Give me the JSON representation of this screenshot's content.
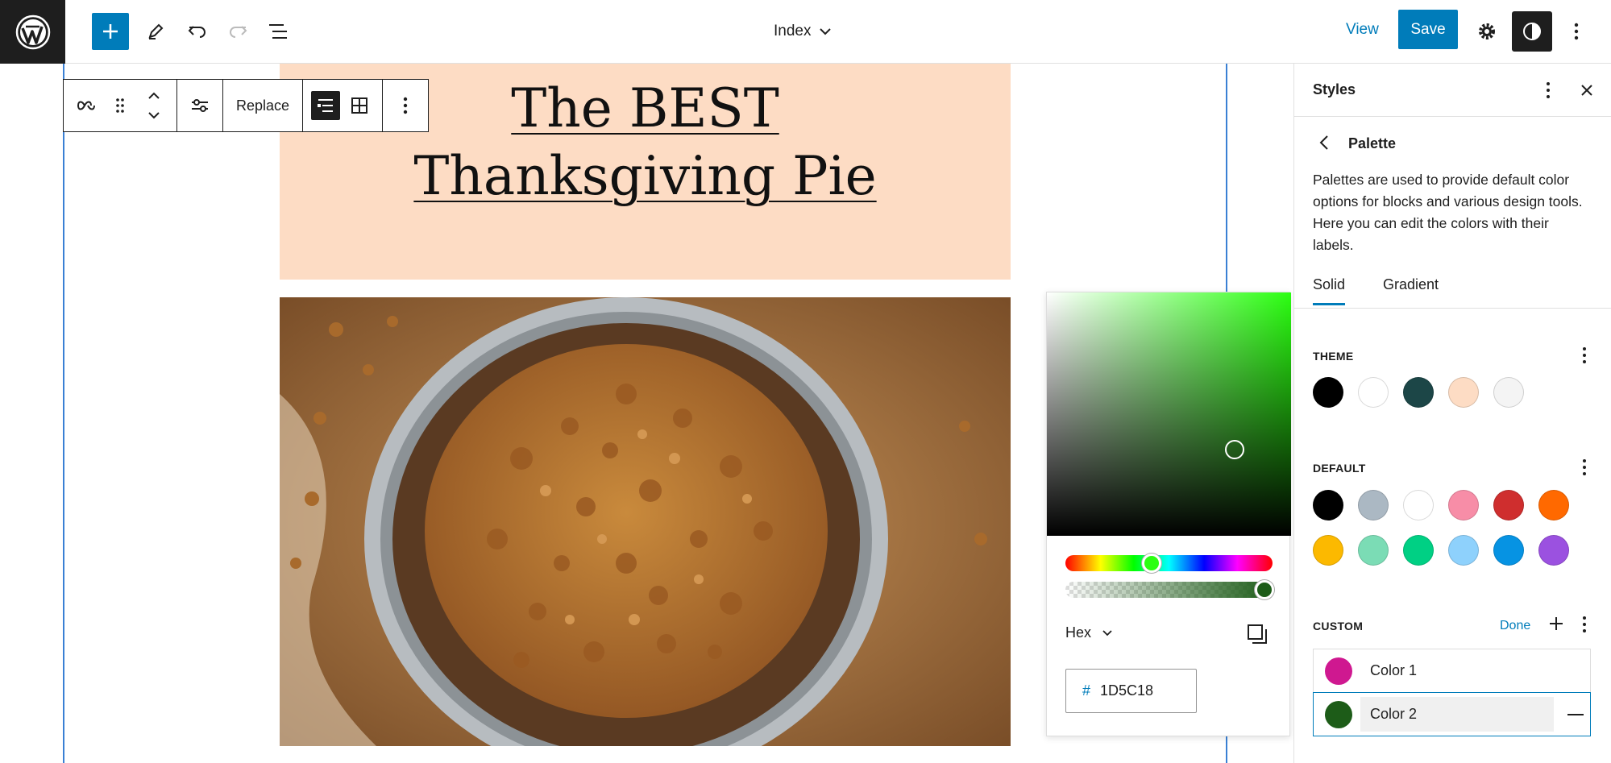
{
  "topbar": {
    "document_title": "Index",
    "view_label": "View",
    "save_label": "Save",
    "icons": [
      "wordpress-logo",
      "add-icon",
      "pencil-icon",
      "undo-icon",
      "redo-icon",
      "list-view-icon",
      "chevron-down-icon",
      "gear-icon",
      "half-circle-icon",
      "more-vertical-icon"
    ]
  },
  "block_toolbar": {
    "replace_label": "Replace",
    "icons": [
      "link-icon",
      "drag-handle-icon",
      "move-up-down-icon",
      "sliders-icon",
      "text-overlay-icon",
      "grid-icon",
      "more-vertical-icon"
    ]
  },
  "canvas": {
    "hero_title_line1": "The BEST",
    "hero_title_line2": "Thanksgiving Pie",
    "hero_background": "#fddcc4"
  },
  "color_picker": {
    "mode_label": "Hex",
    "hex_prefix": "#",
    "hex_value": "1D5C18",
    "hue_color": "#2bff11",
    "alpha": 1.0
  },
  "sidebar": {
    "title": "Styles",
    "subtitle": "Palette",
    "description": "Palettes are used to provide default color options for blocks and various design tools. Here you can edit the colors with their labels.",
    "tabs": [
      {
        "label": "Solid",
        "active": true
      },
      {
        "label": "Gradient",
        "active": false
      }
    ],
    "theme_label": "THEME",
    "theme_colors": [
      "#000000",
      "#ffffff",
      "#1c4647",
      "#fddcc4",
      "#f4f4f4"
    ],
    "default_label": "DEFAULT",
    "default_colors": [
      "#000000",
      "#abb8c3",
      "#ffffff",
      "#f78da7",
      "#cf2e2e",
      "#ff6900",
      "#fcb900",
      "#7bdcb5",
      "#00d084",
      "#8ed1fc",
      "#0693e3",
      "#9b51e0"
    ],
    "custom_label": "CUSTOM",
    "done_label": "Done",
    "custom_colors": [
      {
        "name": "Color 1",
        "color": "#cf1890"
      },
      {
        "name": "Color 2",
        "color": "#1d5c18"
      }
    ]
  }
}
